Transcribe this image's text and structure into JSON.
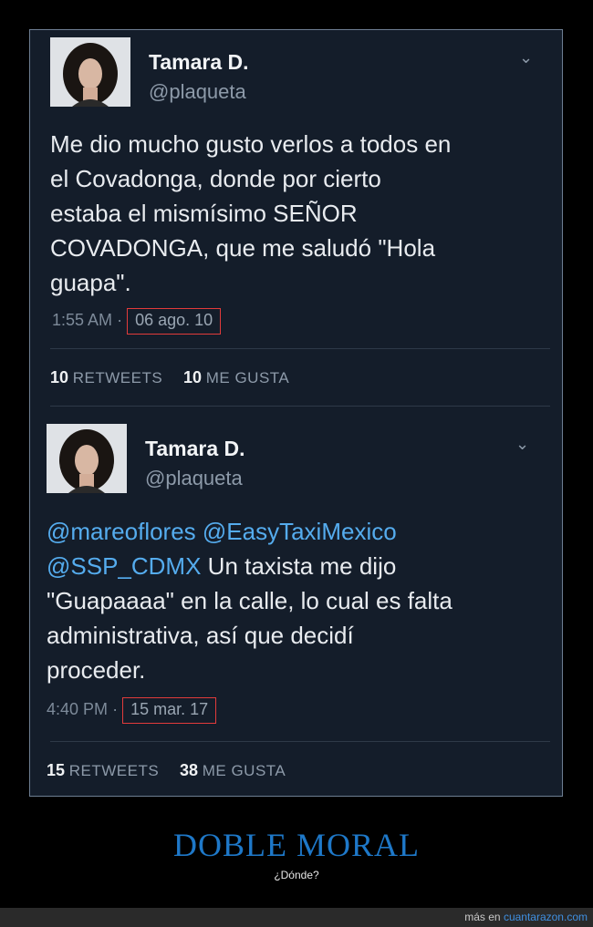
{
  "tweets": [
    {
      "name": "Tamara D.",
      "handle": "@plaqueta",
      "lines": [
        "Me dio mucho gusto verlos a todos en",
        "el Covadonga, donde por cierto",
        "estaba el mismísimo SEÑOR",
        "COVADONGA, que me saludó \"Hola",
        "guapa\"."
      ],
      "time": "1:55 AM",
      "date": "06 ago. 10",
      "retweets": "10",
      "retweets_label": "RETWEETS",
      "likes": "10",
      "likes_label": "ME GUSTA"
    },
    {
      "name": "Tamara D.",
      "handle": "@plaqueta",
      "mention_line_1": "@mareoflores @EasyTaxiMexico",
      "mention_line_2": "@SSP_CDMX",
      "line_2_rest": " Un taxista me dijo",
      "lines": [
        "\"Guapaaaa\" en la calle, lo cual es falta",
        "administrativa, así que decidí",
        "proceder."
      ],
      "time": "4:40 PM",
      "date": "15 mar. 17",
      "retweets": "15",
      "retweets_label": "RETWEETS",
      "likes": "38",
      "likes_label": "ME GUSTA"
    }
  ],
  "caption": {
    "title": "DOBLE MORAL",
    "subtitle": "¿Dónde?"
  },
  "footer": {
    "prefix": "más en ",
    "site": "cuantarazon.com"
  },
  "colors": {
    "tweet_bg": "#141d2a",
    "mention": "#55acee",
    "highlight_box": "#e23b3b",
    "caption_title": "#1e78c8"
  }
}
